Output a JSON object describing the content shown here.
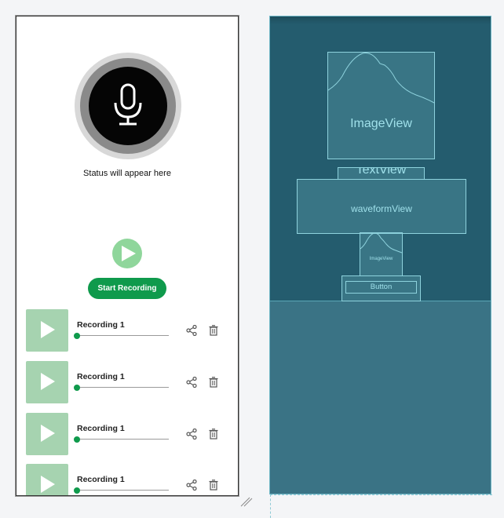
{
  "design": {
    "status_text": "Status will appear here",
    "start_button_label": "Start Recording",
    "recordings": [
      {
        "title": "Recording 1",
        "progress": 0
      },
      {
        "title": "Recording 1",
        "progress": 0
      },
      {
        "title": "Recording 1",
        "progress": 0
      },
      {
        "title": "Recording 1",
        "progress": 0
      }
    ],
    "icons": {
      "mic": "microphone-icon",
      "play": "play-icon",
      "share": "share-icon",
      "delete": "trash-icon"
    },
    "colors": {
      "accent": "#0f9a4c",
      "play_light": "#8fd69b",
      "thumb": "#a6d3b0",
      "mic_bg": "#050505"
    }
  },
  "blueprint": {
    "image_view_label": "ImageView",
    "text_view_label": "TextView",
    "waveform_label": "waveformView",
    "small_image_label": "ImageView",
    "button_label": "Button",
    "colors": {
      "background": "#3a7385",
      "top_region": "#245c6e",
      "outline": "#8ed2dd"
    }
  }
}
